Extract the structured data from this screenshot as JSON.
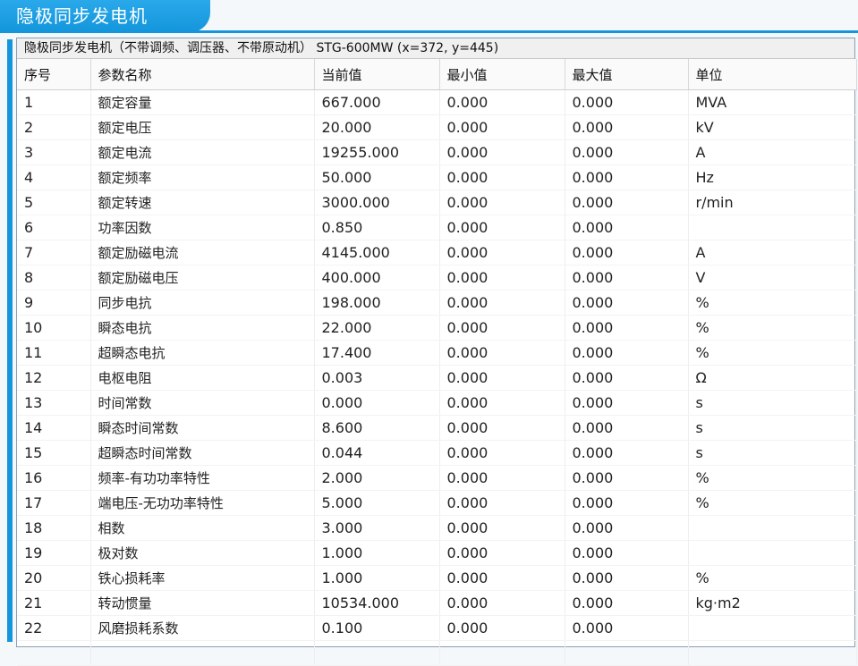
{
  "window": {
    "tab_title": "隐极同步发电机",
    "panel_title": "隐极同步发电机（不带调频、调压器、不带原动机） STG-600MW  (x=372, y=445)"
  },
  "table": {
    "headers": [
      "序号",
      "参数名称",
      "当前值",
      "最小值",
      "最大值",
      "单位"
    ],
    "rows": [
      [
        "1",
        "额定容量",
        "667.000",
        "0.000",
        "0.000",
        "MVA"
      ],
      [
        "2",
        "额定电压",
        "20.000",
        "0.000",
        "0.000",
        "kV"
      ],
      [
        "3",
        "额定电流",
        "19255.000",
        "0.000",
        "0.000",
        "A"
      ],
      [
        "4",
        "额定频率",
        "50.000",
        "0.000",
        "0.000",
        "Hz"
      ],
      [
        "5",
        "额定转速",
        "3000.000",
        "0.000",
        "0.000",
        "r/min"
      ],
      [
        "6",
        "功率因数",
        "0.850",
        "0.000",
        "0.000",
        ""
      ],
      [
        "7",
        "额定励磁电流",
        "4145.000",
        "0.000",
        "0.000",
        "A"
      ],
      [
        "8",
        "额定励磁电压",
        "400.000",
        "0.000",
        "0.000",
        "V"
      ],
      [
        "9",
        "同步电抗",
        "198.000",
        "0.000",
        "0.000",
        "%"
      ],
      [
        "10",
        "瞬态电抗",
        "22.000",
        "0.000",
        "0.000",
        "%"
      ],
      [
        "11",
        "超瞬态电抗",
        "17.400",
        "0.000",
        "0.000",
        "%"
      ],
      [
        "12",
        "电枢电阻",
        "0.003",
        "0.000",
        "0.000",
        "Ω"
      ],
      [
        "13",
        "时间常数",
        "0.000",
        "0.000",
        "0.000",
        "s"
      ],
      [
        "14",
        "瞬态时间常数",
        "8.600",
        "0.000",
        "0.000",
        "s"
      ],
      [
        "15",
        "超瞬态时间常数",
        "0.044",
        "0.000",
        "0.000",
        "s"
      ],
      [
        "16",
        "频率-有功功率特性",
        "2.000",
        "0.000",
        "0.000",
        "%"
      ],
      [
        "17",
        "端电压-无功功率特性",
        "5.000",
        "0.000",
        "0.000",
        "%"
      ],
      [
        "18",
        "相数",
        "3.000",
        "0.000",
        "0.000",
        ""
      ],
      [
        "19",
        "极对数",
        "1.000",
        "0.000",
        "0.000",
        ""
      ],
      [
        "20",
        "铁心损耗率",
        "1.000",
        "0.000",
        "0.000",
        "%"
      ],
      [
        "21",
        "转动惯量",
        "10534.000",
        "0.000",
        "0.000",
        "kg·m2"
      ],
      [
        "22",
        "风磨损耗系数",
        "0.100",
        "0.000",
        "0.000",
        ""
      ]
    ]
  }
}
